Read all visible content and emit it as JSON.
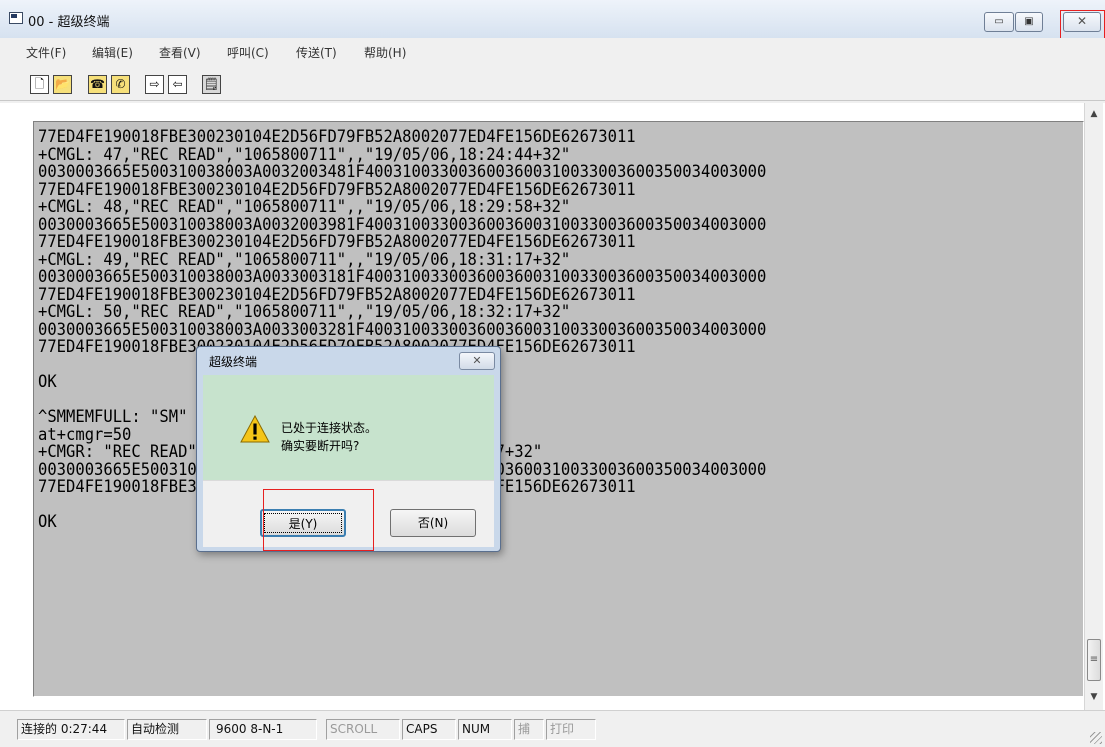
{
  "window": {
    "title": "00 - 超级终端",
    "minimize_label": "▭",
    "maximize_label": "▣",
    "close_label": "✕"
  },
  "menu": [
    "文件(F)",
    "编辑(E)",
    "查看(V)",
    "呼叫(C)",
    "传送(T)",
    "帮助(H)"
  ],
  "toolbar": {
    "new_glyph": "🗋",
    "open_glyph": "📂",
    "call_glyph": "☎",
    "disconnect_glyph": "✆",
    "send_glyph": "⇨",
    "receive_glyph": "⇦",
    "properties_glyph": "🗒"
  },
  "terminal": {
    "lines": [
      "77ED4FE190018FBE300230104E2D56FD79FB52A8002077ED4FE156DE62673011",
      "+CMGL: 47,\"REC READ\",\"1065800711\",,\"19/05/06,18:24:44+32\"",
      "0030003665E500310038003A0032003481F4003100330036003600310033003600350034003000",
      "77ED4FE190018FBE300230104E2D56FD79FB52A8002077ED4FE156DE62673011",
      "+CMGL: 48,\"REC READ\",\"1065800711\",,\"19/05/06,18:29:58+32\"",
      "0030003665E500310038003A0032003981F4003100330036003600310033003600350034003000",
      "77ED4FE190018FBE300230104E2D56FD79FB52A8002077ED4FE156DE62673011",
      "+CMGL: 49,\"REC READ\",\"1065800711\",,\"19/05/06,18:31:17+32\"",
      "0030003665E500310038003A0033003181F4003100330036003600310033003600350034003000",
      "77ED4FE190018FBE300230104E2D56FD79FB52A8002077ED4FE156DE62673011",
      "+CMGL: 50,\"REC READ\",\"1065800711\",,\"19/05/06,18:32:17+32\"",
      "0030003665E500310038003A0033003281F4003100330036003600310033003600350034003000",
      "77ED4FE190018FBE300230104E2D56FD79FB52A8002077ED4FE156DE62673011",
      "",
      "OK",
      "",
      "^SMMEMFULL: \"SM\"",
      "at+cmgr=50",
      "+CMGR: \"REC READ\",\"1065800711\",,\"19/05/06,18:32:17+32\"",
      "0030003665E500310038003A0033003281F4003100330036003600310033003600350034003000",
      "77ED4FE190018FBE300230104E2D56FD79FB52A8002077ED4FE156DE62673011",
      "",
      "OK"
    ]
  },
  "scrollbar": {
    "up_arrow": "▲",
    "down_arrow": "▼",
    "thumb_glyph": "≡"
  },
  "statusbar": {
    "connected": "连接的 0:27:44",
    "detect": "自动检测",
    "settings": "9600 8-N-1",
    "scroll": "SCROLL",
    "caps": "CAPS",
    "num": "NUM",
    "capture": "捕",
    "print": "打印"
  },
  "dialog": {
    "title": "超级终端",
    "close_label": "✕",
    "message_line1": "已处于连接状态。",
    "message_line2": "确实要断开吗?",
    "yes_label": "是(Y)",
    "no_label": "否(N)"
  }
}
